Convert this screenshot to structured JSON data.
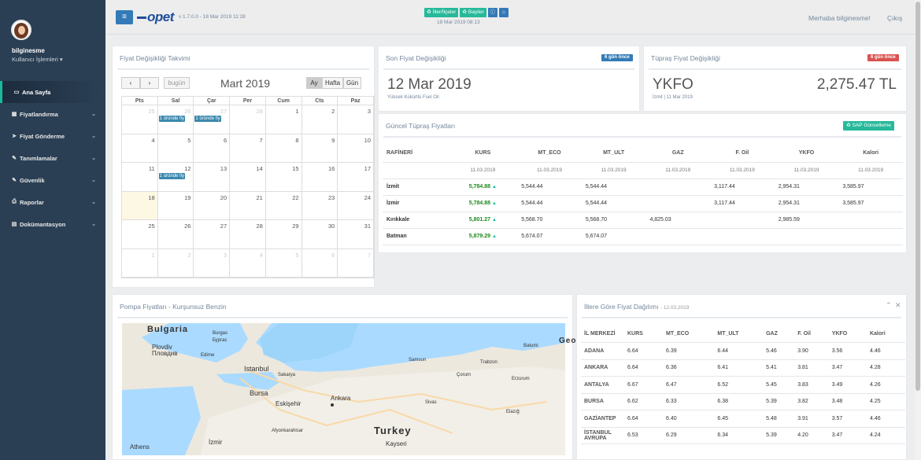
{
  "sidebar": {
    "username": "bilginesme",
    "user_ops": "Kullanıcı İşlemleri",
    "items": [
      {
        "label": "Ana Sayfa"
      },
      {
        "label": "Fiyatlandırma"
      },
      {
        "label": "Fiyat Gönderme"
      },
      {
        "label": "Tanımlamalar"
      },
      {
        "label": "Güvenlik"
      },
      {
        "label": "Raporlar"
      },
      {
        "label": "Dokümantasyon"
      }
    ]
  },
  "topbar": {
    "logo": "opet",
    "version": "v 1.7.0.0 - 18 Mar 2019 11:28",
    "btn_iller": "İller/İlçeler",
    "btn_bayiler": "Bayiler",
    "date": "18 Mar 2019 08:13",
    "greeting": "Merhaba bilginesme!",
    "exit": "Çıkış"
  },
  "calendar": {
    "title": "Fiyat Değişikliği Takvimi",
    "month": "Mart 2019",
    "today_btn": "bugün",
    "view_month": "Ay",
    "view_week": "Hafta",
    "view_day": "Gün",
    "dow": [
      "Pts",
      "Sal",
      "Çar",
      "Per",
      "Cum",
      "Cts",
      "Paz"
    ],
    "weeks": [
      [
        "25",
        "26",
        "27",
        "28",
        "1",
        "2",
        "3"
      ],
      [
        "4",
        "5",
        "6",
        "7",
        "8",
        "9",
        "10"
      ],
      [
        "11",
        "12",
        "13",
        "14",
        "15",
        "16",
        "17"
      ],
      [
        "18",
        "19",
        "20",
        "21",
        "22",
        "23",
        "24"
      ],
      [
        "25",
        "26",
        "27",
        "28",
        "29",
        "30",
        "31"
      ],
      [
        "1",
        "2",
        "3",
        "4",
        "5",
        "6",
        "7"
      ]
    ],
    "event_label": "1 üründe fiy"
  },
  "son_fiyat": {
    "title": "Son Fiyat Değişikliği",
    "badge": "6 gün önce",
    "date": "12 Mar 2019",
    "product": "Yüksek Kükürtlü Fuel Oil"
  },
  "tupras_change": {
    "title": "Tüpraş Fiyat Değişikliği",
    "badge": "6 gün önce",
    "code": "YKFO",
    "value": "2,275.47 TL",
    "sub": "İzmit | 11 Mar 2019"
  },
  "guncel": {
    "title": "Güncel Tüpraş Fiyatları",
    "sap_button": "SAP Güncelleme",
    "headers": [
      "RAFİNERİ",
      "KURS",
      "MT_ECO",
      "MT_ULT",
      "GAZ",
      "F. Oil",
      "YKFO",
      "Kalori"
    ],
    "dates": [
      "",
      "11.03.2019",
      "11.03.2019",
      "11.03.2019",
      "11.03.2019",
      "11.03.2019",
      "11.03.2019",
      "11.03.2019"
    ],
    "rows": [
      [
        "İzmit",
        "5,784.88",
        "5,544.44",
        "5,544.44",
        "",
        "3,117.44",
        "2,954.31",
        "3,585.97"
      ],
      [
        "İzmir",
        "5,784.88",
        "5,544.44",
        "5,544.44",
        "",
        "3,117.44",
        "2,954.31",
        "3,585.97"
      ],
      [
        "Kırıkkale",
        "5,801.27",
        "5,568.70",
        "5,568.70",
        "4,825.03",
        "",
        "2,985.59",
        ""
      ],
      [
        "Batman",
        "5,879.29",
        "5,674.07",
        "5,674.07",
        "",
        "",
        "",
        ""
      ]
    ]
  },
  "pompa": {
    "title": "Pompa Fiyatları - Kurşunsuz Benzin",
    "map_labels": [
      "Bulgaria",
      "Burgas",
      "Бургас",
      "Plovdiv",
      "Пловдив",
      "Edirne",
      "Batumi",
      "Geo",
      "Samsun",
      "Trabzon",
      "Istanbul",
      "Sakarya",
      "Bursa",
      "Eskişehir",
      "Ankara",
      "Sivas",
      "Erzurum",
      "Elazığ",
      "Afyonkarahisar",
      "Turkey",
      "Kayseri",
      "İzmir",
      "Athens",
      "Çorum"
    ]
  },
  "iller": {
    "title": "İllere Göre Fiyat Dağılımı",
    "date": "- 12.03.2019",
    "headers": [
      "İL MERKEZİ",
      "KURS",
      "MT_ECO",
      "MT_ULT",
      "GAZ",
      "F. Oil",
      "YKFO",
      "Kalori"
    ],
    "rows": [
      [
        "ADANA",
        "6.64",
        "6.39",
        "6.44",
        "5.46",
        "3.90",
        "3.56",
        "4.46"
      ],
      [
        "ANKARA",
        "6.64",
        "6.36",
        "6.41",
        "5.41",
        "3.81",
        "3.47",
        "4.28"
      ],
      [
        "ANTALYA",
        "6.67",
        "6.47",
        "6.52",
        "5.45",
        "3.83",
        "3.49",
        "4.26"
      ],
      [
        "BURSA",
        "6.62",
        "6.33",
        "6.38",
        "5.39",
        "3.82",
        "3.48",
        "4.25"
      ],
      [
        "GAZİANTEP",
        "6.64",
        "6.40",
        "6.45",
        "5.48",
        "3.91",
        "3.57",
        "4.46"
      ],
      [
        "İSTANBUL AVRUPA",
        "6.53",
        "6.29",
        "6.34",
        "5.39",
        "4.20",
        "3.47",
        "4.24"
      ]
    ]
  }
}
